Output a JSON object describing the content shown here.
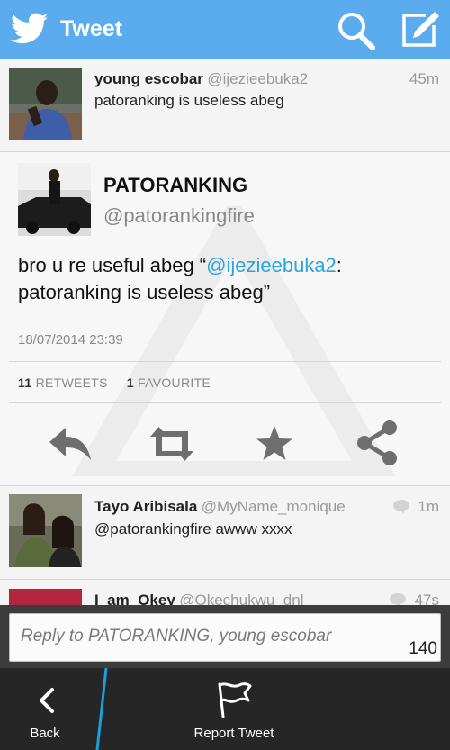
{
  "header": {
    "title": "Tweet"
  },
  "tweets_above": [
    {
      "user": "young escobar",
      "handle": "@ijezieebuka2",
      "time": "45m",
      "text": "patoranking is useless abeg"
    }
  ],
  "main_tweet": {
    "name": "PATORANKING",
    "handle": "@patorankingfire",
    "text_before": "bro u re useful abeg “",
    "mention": "@ijezieebuka2",
    "text_after": ": patoranking is useless abeg”",
    "date": "18/07/2014 23:39",
    "retweets_count": "11",
    "retweets_label": "RETWEETS",
    "favourites_count": "1",
    "favourites_label": "FAVOURITE"
  },
  "replies": [
    {
      "user": "Tayo Aribisala",
      "handle": "@MyName_monique",
      "time": "1m",
      "text": "@patorankingfire awww xxxx"
    },
    {
      "user": "I_am_Okey",
      "handle": "@Okechukwu_dnl",
      "time": "47s",
      "text": ""
    }
  ],
  "reply_box": {
    "placeholder": "Reply to PATORANKING, young escobar",
    "char_count": "140"
  },
  "bottom_bar": {
    "back_label": "Back",
    "report_label": "Report Tweet"
  },
  "colors": {
    "header": "#5aacef",
    "mention": "#2aa4d9",
    "bottombar": "#262626",
    "accent_line": "#1aa0db"
  },
  "icons": [
    "twitter-bird-icon",
    "search-icon",
    "compose-icon",
    "reply-icon",
    "retweet-icon",
    "favourite-icon",
    "share-icon",
    "comment-icon",
    "back-chevron-icon",
    "flag-icon"
  ]
}
